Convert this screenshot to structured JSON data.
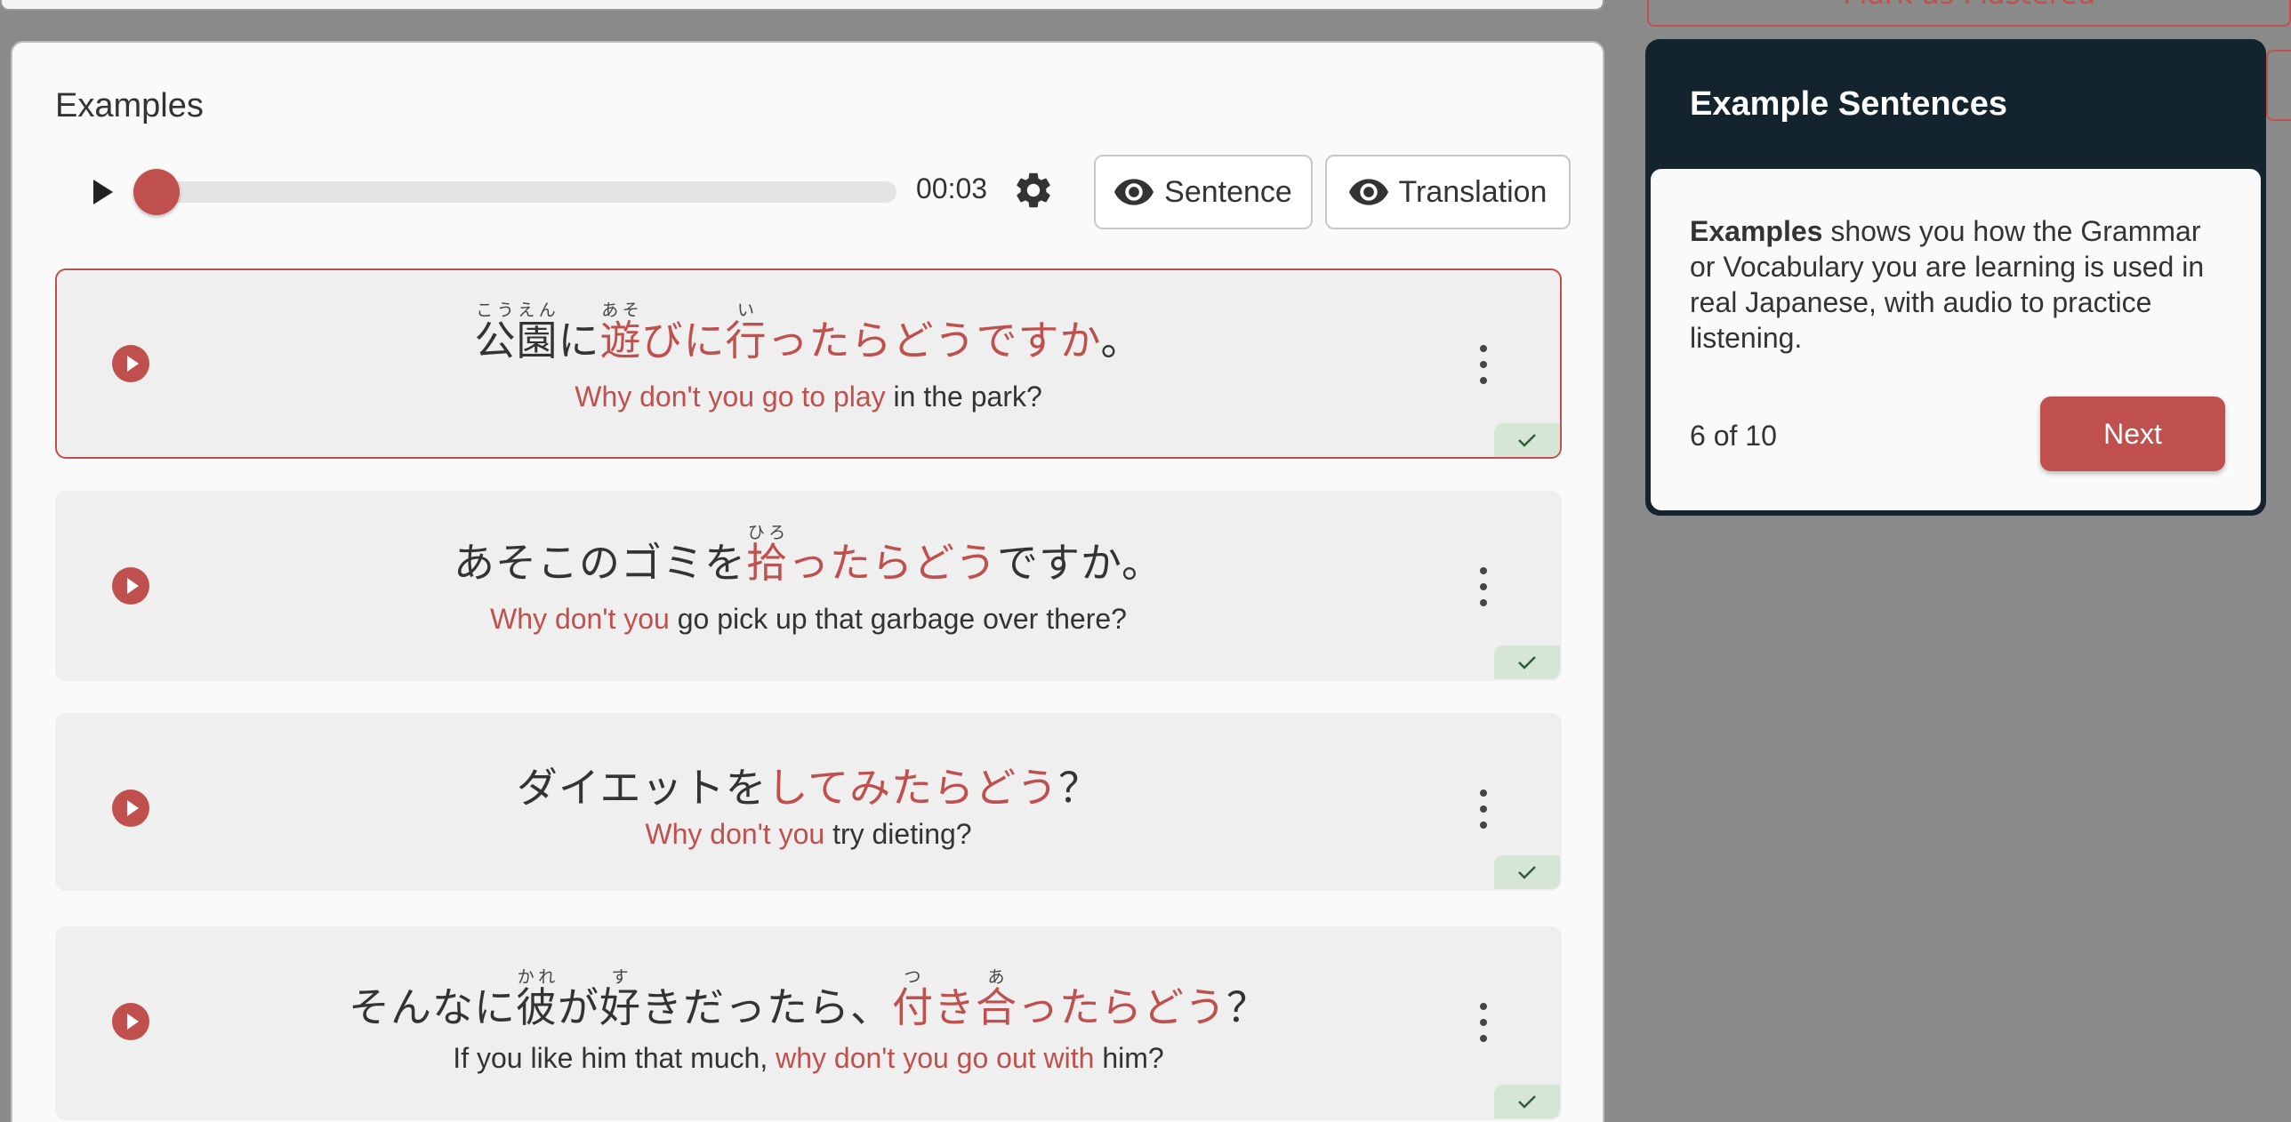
{
  "top_right": {
    "label": "Mark as Mastered"
  },
  "examples": {
    "title": "Examples",
    "player": {
      "time": "00:03",
      "progress": 0.03,
      "sentence_label": "Sentence",
      "translation_label": "Translation"
    },
    "items": [
      {
        "jp_before": "",
        "jp_parts": [
          {
            "base": "公園",
            "ruby": "こうえん",
            "hl": false
          },
          {
            "base": "に",
            "ruby": "",
            "hl": false
          },
          {
            "base": "遊",
            "ruby": "あそ",
            "hl": true
          },
          {
            "base": "びに",
            "ruby": "",
            "hl": true
          },
          {
            "base": "行",
            "ruby": "い",
            "hl": true
          },
          {
            "base": "ったらどうですか",
            "ruby": "",
            "hl": true
          },
          {
            "base": "。",
            "ruby": "",
            "hl": false
          }
        ],
        "en_parts": [
          {
            "text": "Why don't you go to play",
            "hl": true
          },
          {
            "text": " in the park?",
            "hl": false
          }
        ],
        "active": true
      },
      {
        "jp_parts": [
          {
            "base": "あそこのゴミを",
            "ruby": "",
            "hl": false
          },
          {
            "base": "拾",
            "ruby": "ひろ",
            "hl": true
          },
          {
            "base": "ったらどう",
            "ruby": "",
            "hl": true
          },
          {
            "base": "ですか。",
            "ruby": "",
            "hl": false
          }
        ],
        "en_parts": [
          {
            "text": "Why don't you",
            "hl": true
          },
          {
            "text": " go pick up that garbage over there?",
            "hl": false
          }
        ],
        "active": false
      },
      {
        "jp_parts": [
          {
            "base": "ダイエットを",
            "ruby": "",
            "hl": false
          },
          {
            "base": "してみたらどう",
            "ruby": "",
            "hl": true
          },
          {
            "base": "？",
            "ruby": "",
            "hl": false
          }
        ],
        "en_parts": [
          {
            "text": "Why don't you",
            "hl": true
          },
          {
            "text": " try dieting?",
            "hl": false
          }
        ],
        "active": false
      },
      {
        "jp_parts": [
          {
            "base": "そんなに",
            "ruby": "",
            "hl": false
          },
          {
            "base": "彼",
            "ruby": "かれ",
            "hl": false
          },
          {
            "base": "が",
            "ruby": "",
            "hl": false
          },
          {
            "base": "好",
            "ruby": "す",
            "hl": false
          },
          {
            "base": "きだったら、",
            "ruby": "",
            "hl": false
          },
          {
            "base": "付",
            "ruby": "つ",
            "hl": true
          },
          {
            "base": "き",
            "ruby": "",
            "hl": true
          },
          {
            "base": "合",
            "ruby": "あ",
            "hl": true
          },
          {
            "base": "ったらどう",
            "ruby": "",
            "hl": true
          },
          {
            "base": "？",
            "ruby": "",
            "hl": false
          }
        ],
        "en_parts": [
          {
            "text": "If you like him that much, ",
            "hl": false
          },
          {
            "text": "why don't you go out with",
            "hl": true
          },
          {
            "text": " him?",
            "hl": false
          }
        ],
        "active": false
      }
    ]
  },
  "tour": {
    "title": "Example Sentences",
    "body_bold": "Examples",
    "body_rest": " shows you how the Grammar or Vocabulary you are learning is used in real Japanese, with audio to practice listening.",
    "count": "6 of 10",
    "next_label": "Next"
  },
  "colors": {
    "accent": "#c0504d",
    "tour_header": "#13242e",
    "check_bg": "#d6e6d6"
  },
  "icons": {
    "play": "play-icon",
    "settings": "gear-icon",
    "visibility": "eye-icon",
    "more": "more-vertical-icon",
    "check": "check-icon"
  }
}
